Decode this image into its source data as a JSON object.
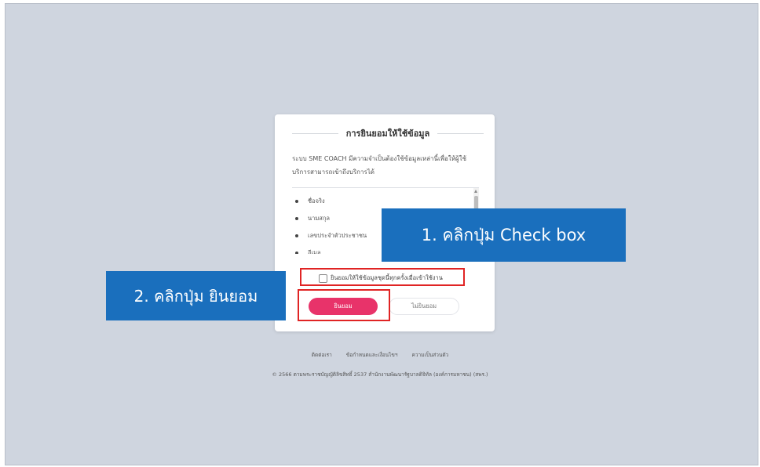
{
  "consent_dialog": {
    "title": "การยินยอมให้ใช้ข้อมูล",
    "description": "ระบบ SME COACH มีความจำเป็นต้องใช้ข้อมูลเหล่านี้เพื่อให้ผู้ใช้บริการสามารถเข้าถึงบริการได้",
    "data_items": [
      "ชื่อจริง",
      "นามสกุล",
      "เลขประจำตัวประชาชน",
      "อีเมล"
    ],
    "checkbox_label": "ยินยอมให้ใช้ข้อมูลชุดนี้ทุกครั้งเมื่อเข้าใช้งาน",
    "checkbox_checked": false,
    "accept_label": "ยินยอม",
    "decline_label": "ไม่ยินยอม",
    "accent_color": "#e8336a"
  },
  "footer": {
    "links": [
      "ติดต่อเรา",
      "ข้อกำหนดและเงื่อนไขฯ",
      "ความเป็นส่วนตัว"
    ],
    "copyright": "© 2566 ตามพระราชบัญญัติลิขสิทธิ์ 2537 สำนักงานพัฒนารัฐบาลดิจิทัล (องค์การมหาชน) (สพร.)"
  },
  "annotations": {
    "step1": "1. คลิกปุ่ม Check box",
    "step2": "2. คลิกปุ่ม ยินยอม",
    "callout_color": "#1a6fbd",
    "highlight_color": "#e02424"
  }
}
